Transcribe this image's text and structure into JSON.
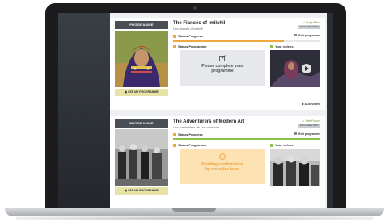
{
  "colors": {
    "progress_orange": "#f0a940",
    "progress_green": "#8bc34a",
    "see_button": "#e7e3a6",
    "programme_tag": "#4a4f55"
  },
  "cards": [
    {
      "tag": "PROGRAMME",
      "title": "The Fiancés of Imilchil",
      "subtitle": "Les fiancés d'Imilchil",
      "owner": "✓ Hope Films",
      "badge": "DOCUMENTARY",
      "status_progress_label": "Status Progress",
      "edit_label": "Edit programme",
      "progress": 0.75,
      "progress_color": "orange",
      "status_programme_label": "Status Programme",
      "status_lines": [
        "Please complete your",
        "programme"
      ],
      "status_icon": "edit-icon",
      "videos_label": "Your videos",
      "see_button": "SEE MY PROGRAMME",
      "add_video": "ADD VIDEO"
    },
    {
      "tag": "PROGRAMME",
      "title": "The Adventurers of Modern Art",
      "subtitle": "Les aventuriers de l'art moderne",
      "owner": "✓ Arte France",
      "badge": "DOCUMENTARY",
      "status_progress_label": "Status Progress",
      "edit_label": "Edit programme",
      "progress": 1.0,
      "progress_color": "green",
      "status_programme_label": "Status Programme",
      "status_lines": [
        "Pending confirmation",
        "by our sales team"
      ],
      "status_icon": "clock-icon",
      "videos_label": "Your videos",
      "see_button": "SEE MY PROGRAMME",
      "add_video": "ADD VIDEO"
    }
  ]
}
